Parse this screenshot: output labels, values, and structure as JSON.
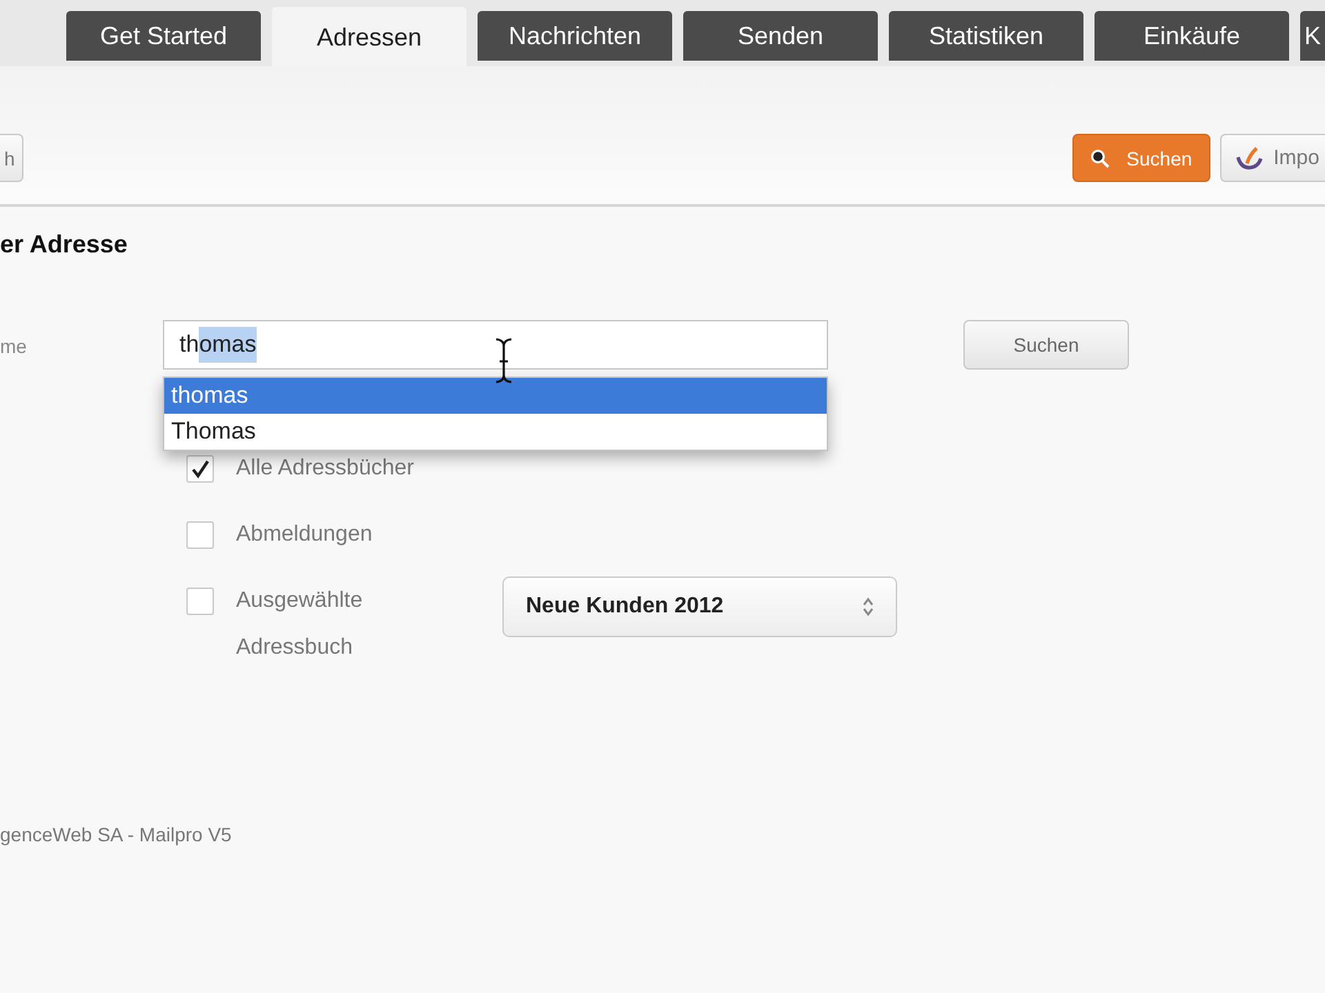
{
  "tabs": [
    {
      "label": "Get Started",
      "selected": false
    },
    {
      "label": "Adressen",
      "selected": true
    },
    {
      "label": "Nachrichten",
      "selected": false
    },
    {
      "label": "Senden",
      "selected": false
    },
    {
      "label": "Statistiken",
      "selected": false
    },
    {
      "label": "Einkäufe",
      "selected": false
    },
    {
      "label": "K",
      "selected": false
    }
  ],
  "toolbar": {
    "left_buttons": [
      {
        "label": "h",
        "active": false
      }
    ],
    "right_buttons": [
      {
        "label": "Suchen",
        "kind": "search",
        "active": true
      },
      {
        "label": "Impo",
        "kind": "import",
        "active": false
      }
    ]
  },
  "heading": "er Adresse",
  "form": {
    "label": "me",
    "input": {
      "typed": "th",
      "autocompleted": "omas"
    },
    "suggestions": [
      {
        "label": "thomas",
        "selected": true
      },
      {
        "label": "Thomas",
        "selected": false
      }
    ],
    "search_button": "Suchen",
    "options": [
      {
        "label": "Alle Adressbücher",
        "checked": true
      },
      {
        "label": "Abmeldungen",
        "checked": false
      },
      {
        "label": "Ausgewählte Adressbuch",
        "checked": false,
        "select": "Neue Kunden 2012"
      }
    ]
  },
  "footer": "genceWeb SA - Mailpro V5"
}
